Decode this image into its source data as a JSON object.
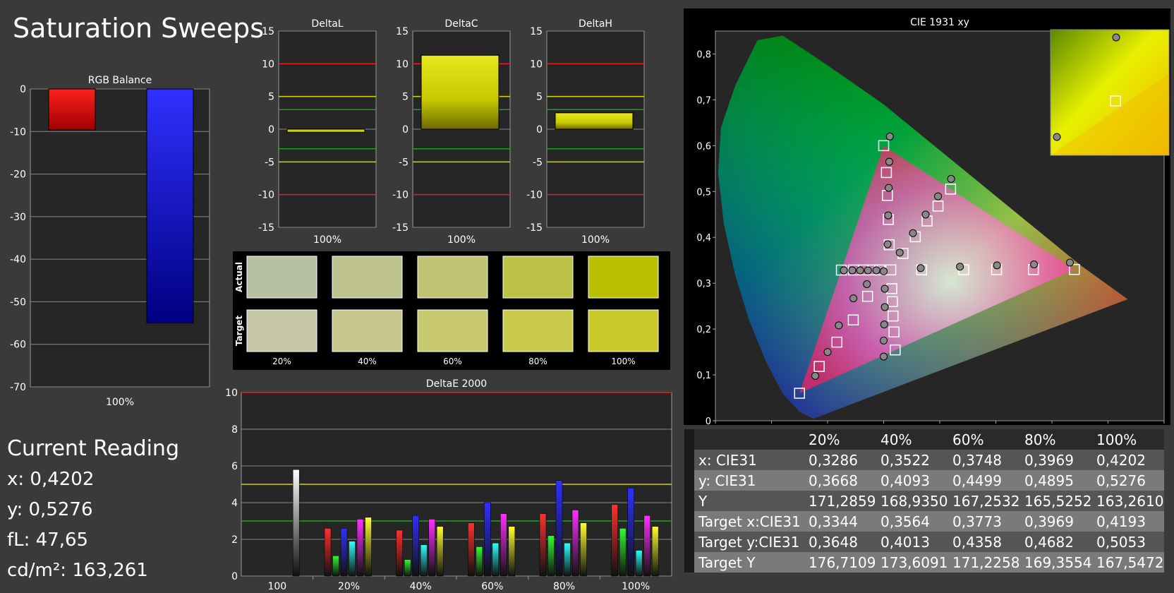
{
  "title": "Saturation Sweeps",
  "current_reading": {
    "heading": "Current Reading",
    "lines": [
      "x: 0,4202",
      "y: 0,5276",
      "fL: 47,65",
      "cd/m²: 163,261"
    ]
  },
  "swatches": {
    "row_labels": [
      "Actual",
      "Target"
    ],
    "labels": [
      "20%",
      "40%",
      "60%",
      "80%",
      "100%"
    ],
    "actual_colors": [
      "#b8c0a3",
      "#bec390",
      "#bfc372",
      "#bcc246",
      "#b9c000"
    ],
    "target_colors": [
      "#c6c6a8",
      "#c8c68f",
      "#c7c770",
      "#c9c94c",
      "#c9c92a"
    ]
  },
  "table": {
    "headers": [
      "",
      "20%",
      "40%",
      "60%",
      "80%",
      "100%"
    ],
    "rows": [
      [
        "x: CIE31",
        "0,3286",
        "0,3522",
        "0,3748",
        "0,3969",
        "0,4202"
      ],
      [
        "y: CIE31",
        "0,3668",
        "0,4093",
        "0,4499",
        "0,4895",
        "0,5276"
      ],
      [
        "Y",
        "171,2859",
        "168,9350",
        "167,2532",
        "165,5252",
        "163,2610"
      ],
      [
        "Target x:CIE31",
        "0,3344",
        "0,3564",
        "0,3773",
        "0,3969",
        "0,4193"
      ],
      [
        "Target y:CIE31",
        "0,3648",
        "0,4013",
        "0,4358",
        "0,4682",
        "0,5053"
      ],
      [
        "Target Y",
        "176,7109",
        "173,6091",
        "171,2258",
        "169,3554",
        "167,5472"
      ]
    ]
  },
  "chart_data": [
    {
      "type": "bar",
      "title": "RGB Balance",
      "categories": [
        "100%"
      ],
      "series": [
        {
          "color": "#ff0000",
          "values": [
            -9.6
          ]
        },
        {
          "color": "#0000ff",
          "values": [
            -55
          ]
        }
      ],
      "ylim": [
        -70,
        0
      ],
      "yticks": [
        0,
        -10,
        -20,
        -30,
        -40,
        -50,
        -60,
        -70
      ],
      "grid": true
    },
    {
      "type": "bar",
      "title": "DeltaL",
      "categories": [
        "100%"
      ],
      "values": [
        -0.5
      ],
      "ylim": [
        -15,
        15
      ],
      "yticks": [
        15,
        10,
        5,
        0,
        -5,
        -10,
        -15
      ],
      "grid": true
    },
    {
      "type": "bar",
      "title": "DeltaC",
      "categories": [
        "100%"
      ],
      "values": [
        11.3
      ],
      "ylim": [
        -15,
        15
      ],
      "yticks": [
        15,
        10,
        5,
        0,
        -5,
        -10,
        -15
      ],
      "grid": true
    },
    {
      "type": "bar",
      "title": "DeltaH",
      "categories": [
        "100%"
      ],
      "values": [
        2.5
      ],
      "ylim": [
        -15,
        15
      ],
      "yticks": [
        15,
        10,
        5,
        0,
        -5,
        -10,
        -15
      ],
      "grid": true
    },
    {
      "type": "bar",
      "title": "DeltaE 2000",
      "categories": [
        "100",
        "20%",
        "40%",
        "60%",
        "80%",
        "100%"
      ],
      "series": [
        {
          "color": "#ff3030",
          "values": [
            null,
            2.6,
            2.5,
            2.9,
            3.4,
            3.9
          ]
        },
        {
          "color": "#30ff30",
          "values": [
            null,
            1.1,
            0.9,
            1.6,
            2.2,
            2.6
          ]
        },
        {
          "color": "#3030ff",
          "values": [
            null,
            2.6,
            3.3,
            4.0,
            5.2,
            4.8
          ]
        },
        {
          "color": "#30ffff",
          "values": [
            null,
            1.9,
            1.7,
            1.8,
            1.8,
            1.4
          ]
        },
        {
          "color": "#ff30ff",
          "values": [
            null,
            3.1,
            3.1,
            3.4,
            3.6,
            3.3
          ]
        },
        {
          "color": "#ffff30",
          "values": [
            null,
            3.2,
            2.7,
            2.7,
            2.9,
            2.7
          ]
        },
        {
          "color": "#ffffff",
          "values": [
            5.8,
            null,
            null,
            null,
            null,
            null
          ]
        }
      ],
      "ylim": [
        0,
        10
      ],
      "yticks": [
        0,
        2,
        4,
        6,
        8,
        10
      ],
      "grid": true
    },
    {
      "type": "scatter",
      "title": "CIE 1931 xy",
      "xlim": [
        0,
        0.8
      ],
      "ylim": [
        0,
        0.85
      ],
      "xticks": [
        "0",
        "0,1",
        "0,2",
        "0,3",
        "0,4",
        "0,5",
        "0,6",
        "0,7",
        "0,8"
      ],
      "yticks": [
        "0",
        "0,1",
        "0,2",
        "0,3",
        "0,4",
        "0,5",
        "0,6",
        "0,7",
        "0,8"
      ],
      "gamut_triangle": [
        [
          0.64,
          0.33
        ],
        [
          0.3,
          0.6
        ],
        [
          0.15,
          0.06
        ]
      ],
      "series": [
        {
          "marker": "square",
          "points": [
            [
              0.3127,
              0.329
            ],
            [
              0.3344,
              0.3648
            ],
            [
              0.3564,
              0.4013
            ],
            [
              0.3773,
              0.4358
            ],
            [
              0.3969,
              0.4682
            ],
            [
              0.4193,
              0.5053
            ],
            [
              0.3,
              0.6
            ],
            [
              0.3049,
              0.5414
            ],
            [
              0.3066,
              0.4915
            ],
            [
              0.3082,
              0.439
            ],
            [
              0.3098,
              0.3839
            ],
            [
              0.64,
              0.33
            ],
            [
              0.5669,
              0.3298
            ],
            [
              0.5013,
              0.3296
            ],
            [
              0.4426,
              0.3294
            ],
            [
              0.3677,
              0.3292
            ],
            [
              0.15,
              0.06
            ],
            [
              0.1851,
              0.1185
            ],
            [
              0.2167,
              0.1715
            ],
            [
              0.2458,
              0.2198
            ],
            [
              0.2713,
              0.2715
            ],
            [
              0.3205,
              0.1545
            ],
            [
              0.3184,
              0.1936
            ],
            [
              0.3168,
              0.2285
            ],
            [
              0.3156,
              0.2598
            ],
            [
              0.3145,
              0.288
            ],
            [
              0.2246,
              0.3287
            ],
            [
              0.246,
              0.3288
            ],
            [
              0.2644,
              0.3289
            ],
            [
              0.28,
              0.3289
            ],
            [
              0.2931,
              0.3289
            ]
          ]
        },
        {
          "marker": "circle",
          "points": [
            [
              0.3,
              0.326
            ],
            [
              0.3286,
              0.3668
            ],
            [
              0.3522,
              0.4093
            ],
            [
              0.3748,
              0.4499
            ],
            [
              0.3969,
              0.4895
            ],
            [
              0.4202,
              0.5276
            ],
            [
              0.311,
              0.62
            ],
            [
              0.31,
              0.565
            ],
            [
              0.309,
              0.508
            ],
            [
              0.308,
              0.448
            ],
            [
              0.307,
              0.385
            ],
            [
              0.632,
              0.345
            ],
            [
              0.568,
              0.341
            ],
            [
              0.502,
              0.339
            ],
            [
              0.436,
              0.336
            ],
            [
              0.366,
              0.333
            ],
            [
              0.178,
              0.098
            ],
            [
              0.2,
              0.15
            ],
            [
              0.22,
              0.208
            ],
            [
              0.246,
              0.267
            ],
            [
              0.27,
              0.298
            ],
            [
              0.3,
              0.14
            ],
            [
              0.3,
              0.175
            ],
            [
              0.301,
              0.21
            ],
            [
              0.302,
              0.248
            ],
            [
              0.302,
              0.288
            ],
            [
              0.229,
              0.328
            ],
            [
              0.244,
              0.328
            ],
            [
              0.258,
              0.328
            ],
            [
              0.272,
              0.328
            ],
            [
              0.287,
              0.328
            ]
          ]
        }
      ]
    }
  ]
}
